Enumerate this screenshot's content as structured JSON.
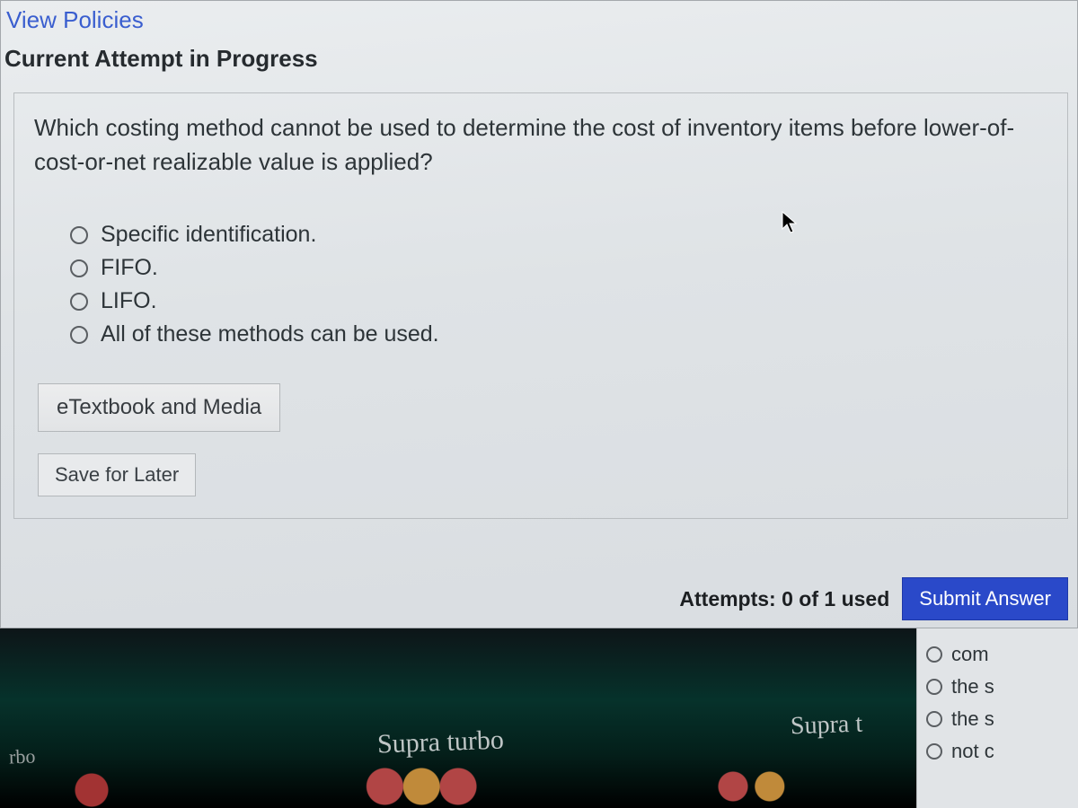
{
  "header": {
    "view_policies": "View Policies",
    "attempt_heading": "Current Attempt in Progress"
  },
  "question": {
    "text": "Which costing method cannot be used to determine the cost of inventory items before lower-of-cost-or-net realizable value is applied?",
    "options": [
      "Specific identification.",
      "FIFO.",
      "LIFO.",
      "All of these methods can be used."
    ]
  },
  "buttons": {
    "etextbook": "eTextbook and Media",
    "save_later": "Save for Later",
    "submit": "Submit Answer"
  },
  "attempts": {
    "label": "Attempts: 0 of 1 used"
  },
  "background_window": {
    "options": [
      "com",
      "the s",
      "the s",
      "not c"
    ]
  },
  "photo_text": {
    "a": "Supra turbo",
    "b": "Supra t",
    "c": "rbo"
  }
}
